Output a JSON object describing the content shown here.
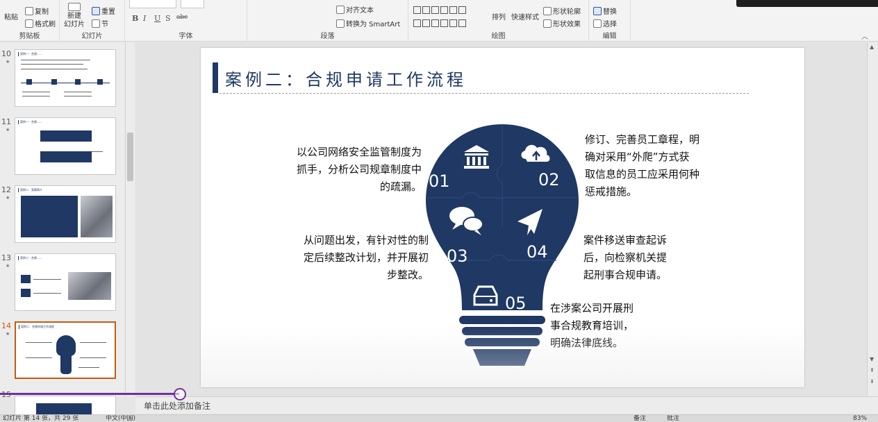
{
  "ribbon": {
    "clipboard": {
      "paste": "粘贴",
      "copy": "复制",
      "format_painter": "格式刷",
      "group": "剪贴板"
    },
    "slides": {
      "new_slide": "新建\n幻灯片",
      "reset": "重置",
      "section": "节",
      "group": "幻灯片"
    },
    "font": {
      "group": "字体",
      "bold": "B",
      "italic": "I",
      "underline": "U",
      "shadow": "S",
      "strike": "abc"
    },
    "paragraph": {
      "align_text": "对齐文本",
      "convert_smartart": "转换为 SmartArt",
      "group": "段落"
    },
    "drawing": {
      "arrange": "排列",
      "quick_styles": "快速样式",
      "shape_outline": "形状轮廓",
      "shape_effects": "形状效果",
      "group": "绘图"
    },
    "editing": {
      "replace": "替换",
      "select": "选择",
      "group": "编辑"
    }
  },
  "thumbnails": [
    {
      "number": "10",
      "title": "案例一：合规……"
    },
    {
      "number": "11",
      "title": "案例一：合规……"
    },
    {
      "number": "12",
      "title": "案例二：案情简介"
    },
    {
      "number": "13",
      "title": "案例二：合规……"
    },
    {
      "number": "14",
      "title": "案例二：合规申请工作流程"
    }
  ],
  "thumb15_number": "15",
  "slide": {
    "title": "案例二：合规申请工作流程",
    "steps": [
      {
        "num": "01",
        "icon": "bank-icon",
        "text": "以公司网络安全监管制度为抓手，分析公司规章制度中的疏漏。"
      },
      {
        "num": "02",
        "icon": "cloud-upload-icon",
        "text": "修订、完善员工章程，明确对采用“外爬”方式获取信息的员工应采用何种惩戒措施。"
      },
      {
        "num": "03",
        "icon": "chat-bubbles-icon",
        "text": "从问题出发，有针对性的制定后续整改计划，并开展初步整改。"
      },
      {
        "num": "04",
        "icon": "paper-plane-icon",
        "text": "案件移送审查起诉后，向检察机关提起刑事合规申请。"
      },
      {
        "num": "05",
        "icon": "hard-drive-icon",
        "text": "在涉案公司开展刑事合规教育培训，明确法律底线。"
      }
    ],
    "text_lines": {
      "s1": [
        "以公司网络安全监管制度为",
        "抓手，分析公司规章制度中",
        "的疏漏。"
      ],
      "s2": [
        "修订、完善员工章程，明",
        "确对采用“外爬”方式获",
        "取信息的员工应采用何种",
        "惩戒措施。"
      ],
      "s3": [
        "从问题出发，有针对性的制",
        "定后续整改计划，并开展初",
        "步整改。"
      ],
      "s4": [
        "案件移送审查起诉",
        "后，向检察机关提",
        "起刑事合规申请。"
      ],
      "s5": [
        "在涉案公司开展刑",
        "事合规教育培训，",
        "明确法律底线。"
      ]
    }
  },
  "notes_placeholder": "单击此处添加备注",
  "status": {
    "slide_info": "幻灯片 第 14 张，共 29 张",
    "language": "中文(中国)",
    "notes": "备注",
    "comments": "批注",
    "zoom": "83%"
  },
  "colors": {
    "navy": "#1f3864",
    "accent_orange": "#c55a11",
    "progress_purple": "#7030a0"
  }
}
